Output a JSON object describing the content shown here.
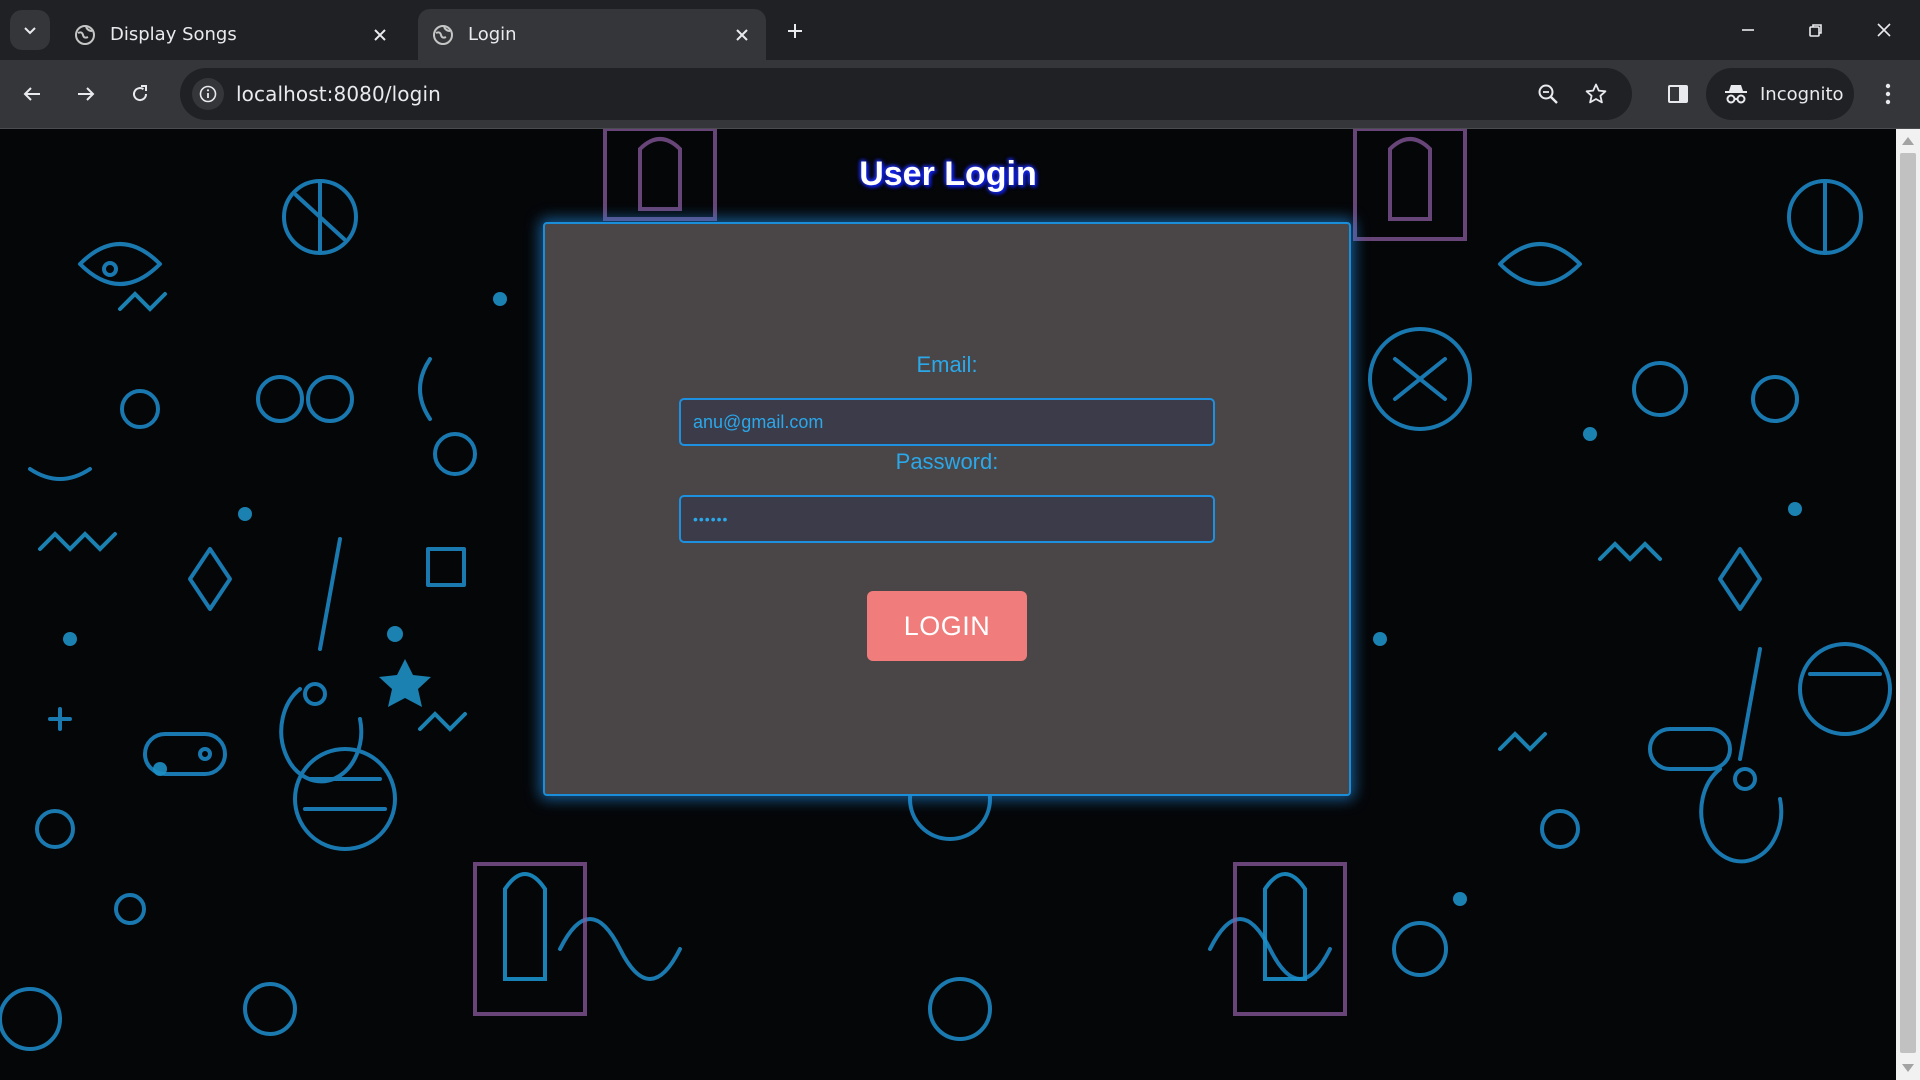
{
  "browser": {
    "tabs": [
      {
        "title": "Display Songs",
        "active": false,
        "icon": "globe-icon"
      },
      {
        "title": "Login",
        "active": true,
        "icon": "globe-icon"
      }
    ],
    "address_bar": {
      "url": "localhost:8080/login"
    },
    "profile_label": "Incognito"
  },
  "page": {
    "heading": "User Login",
    "form": {
      "email_label": "Email:",
      "email_value": "anu@gmail.com",
      "password_label": "Password:",
      "password_mask": "••••••",
      "submit_label": "LOGIN"
    }
  },
  "colors": {
    "accent_blue": "#2aa8ea",
    "card_bg": "#4a4647",
    "button_bg": "#f07c7c",
    "page_bg": "#050608",
    "doodle_cyan": "#1b7fb8",
    "doodle_purple": "#8a5a9e"
  }
}
